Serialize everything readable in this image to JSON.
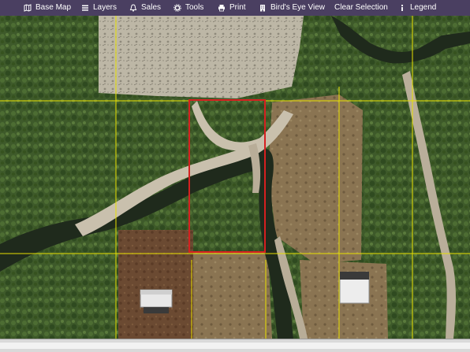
{
  "toolbar": {
    "items": [
      {
        "label": "Base Map",
        "icon": "map-icon"
      },
      {
        "label": "Layers",
        "icon": "layers-icon"
      },
      {
        "label": "Sales",
        "icon": "bell-icon"
      },
      {
        "label": "Tools",
        "icon": "gear-icon"
      },
      {
        "label": "Print",
        "icon": "print-icon"
      },
      {
        "label": "Bird's Eye View",
        "icon": "building-icon"
      },
      {
        "label": "Clear Selection",
        "icon": ""
      },
      {
        "label": "Legend",
        "icon": "info-icon"
      }
    ]
  },
  "map": {
    "type": "aerial-imagery",
    "selected_parcel_color": "#d62020",
    "parcel_line_color": "#e8e000"
  },
  "colors": {
    "toolbar_bg": "#4a3f61",
    "toolbar_text": "#ffffff"
  }
}
